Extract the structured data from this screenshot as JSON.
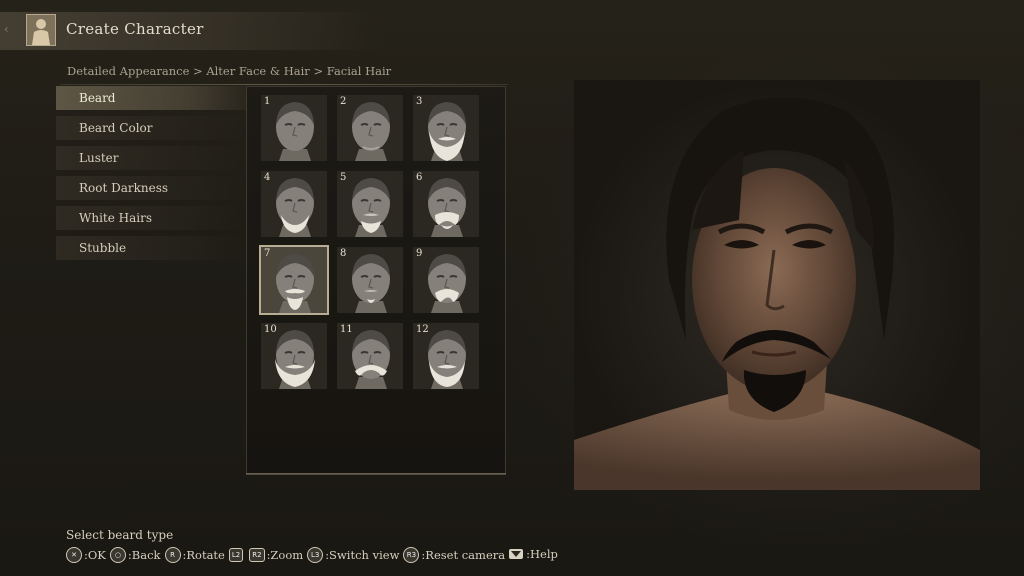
{
  "header": {
    "title": "Create Character"
  },
  "breadcrumb": "Detailed Appearance > Alter Face & Hair > Facial Hair",
  "menu": {
    "items": [
      {
        "label": "Beard",
        "selected": true
      },
      {
        "label": "Beard Color",
        "selected": false
      },
      {
        "label": "Luster",
        "selected": false
      },
      {
        "label": "Root Darkness",
        "selected": false
      },
      {
        "label": "White Hairs",
        "selected": false
      },
      {
        "label": "Stubble",
        "selected": false
      }
    ]
  },
  "beard_grid": {
    "selected_index": 7,
    "cells": [
      {
        "num": "1",
        "style": "none"
      },
      {
        "num": "2",
        "style": "light"
      },
      {
        "num": "3",
        "style": "full"
      },
      {
        "num": "4",
        "style": "goatee-wide"
      },
      {
        "num": "5",
        "style": "chin"
      },
      {
        "num": "6",
        "style": "mustache-chin"
      },
      {
        "num": "7",
        "style": "goatee"
      },
      {
        "num": "8",
        "style": "soul"
      },
      {
        "num": "9",
        "style": "mustache"
      },
      {
        "num": "10",
        "style": "full-short"
      },
      {
        "num": "11",
        "style": "mustache-wide"
      },
      {
        "num": "12",
        "style": "full-medium"
      }
    ]
  },
  "footer": {
    "hint": "Select beard type",
    "controls": [
      {
        "button": "✕",
        "shape": "round",
        "label": ":OK"
      },
      {
        "button": "○",
        "shape": "round",
        "label": ":Back"
      },
      {
        "button": "R",
        "shape": "round",
        "label": ":Rotate"
      },
      {
        "button": "L2",
        "shape": "rect",
        "label": ""
      },
      {
        "button": "R2",
        "shape": "rect",
        "label": ":Zoom"
      },
      {
        "button": "L3",
        "shape": "round",
        "label": ":Switch view"
      },
      {
        "button": "R3",
        "shape": "round",
        "label": ":Reset camera"
      },
      {
        "button": "",
        "shape": "tri",
        "label": ":Help"
      }
    ]
  },
  "colors": {
    "accent": "#b8ad92",
    "text": "#d6cfbe",
    "beard_preview": "#e8e4da"
  }
}
